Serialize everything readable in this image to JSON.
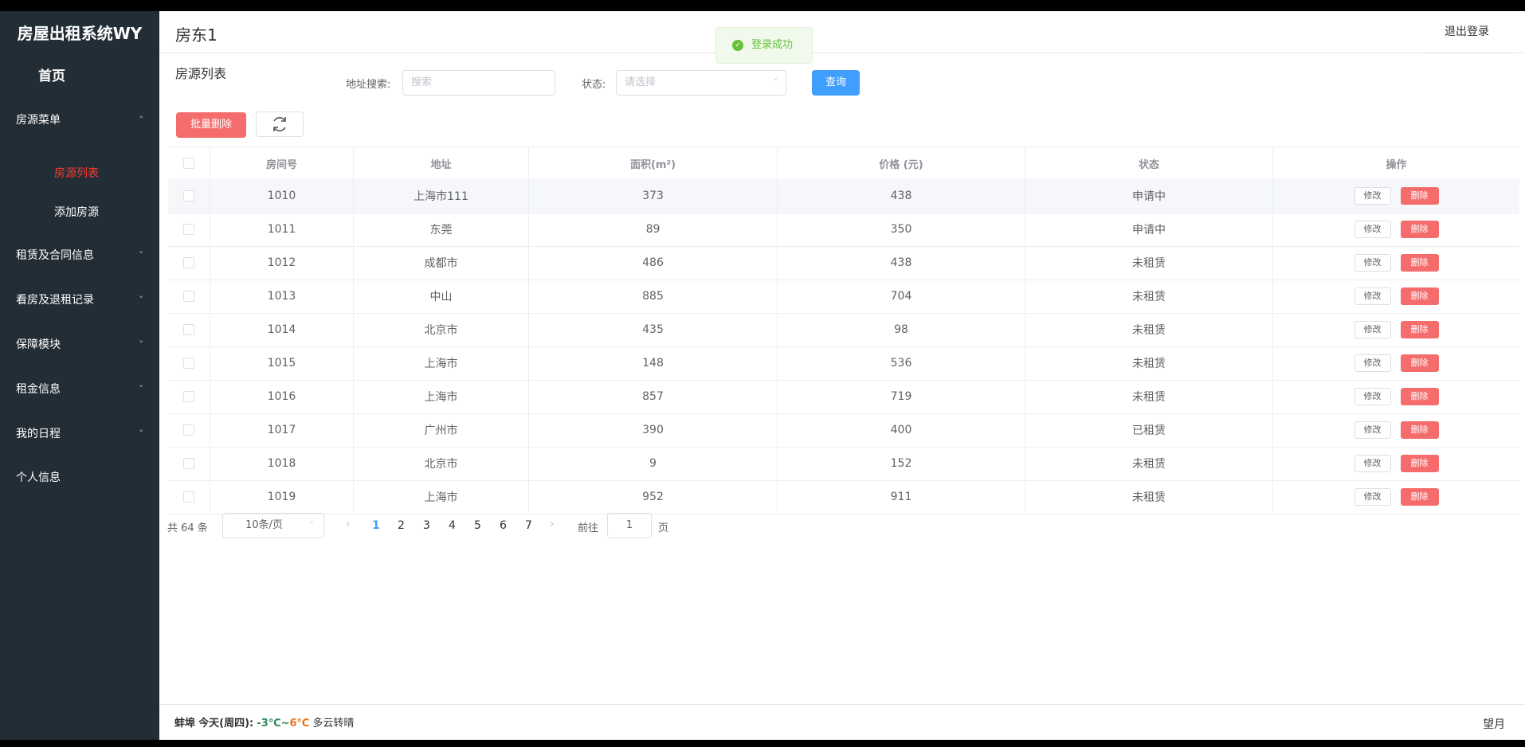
{
  "app": {
    "title": "房屋出租系统WY"
  },
  "sidebar": {
    "home": "首页",
    "groups": [
      {
        "label": "房源菜单",
        "chevron": "chevron-up-icon"
      },
      {
        "label": "租赁及合同信息",
        "chevron": "chevron-down-icon"
      },
      {
        "label": "看房及退租记录",
        "chevron": "chevron-down-icon"
      },
      {
        "label": "保障模块",
        "chevron": "chevron-down-icon"
      },
      {
        "label": "租金信息",
        "chevron": "chevron-down-icon"
      },
      {
        "label": "我的日程",
        "chevron": "chevron-down-icon"
      }
    ],
    "sub_items": [
      "房源列表",
      "添加房源"
    ],
    "personal": "个人信息",
    "active_color": "#ff3b30"
  },
  "header": {
    "title": "房东1",
    "logout": "退出登录"
  },
  "toast": {
    "message": "登录成功"
  },
  "toolbar": {
    "panel_title": "房源列表",
    "address_label": "地址搜索:",
    "address_placeholder": "搜索",
    "status_label": "状态:",
    "status_placeholder": "请选择",
    "query_button": "查询",
    "batch_delete_button": "批量删除",
    "refresh_icon": "refresh-icon"
  },
  "table": {
    "headers": [
      "房间号",
      "地址",
      "面积(m²)",
      "价格 (元)",
      "状态",
      "操作"
    ],
    "edit_label": "修改",
    "delete_label": "删除",
    "rows": [
      {
        "room": "1010",
        "address": "上海市111",
        "area": "373",
        "price": "438",
        "status": "申请中"
      },
      {
        "room": "1011",
        "address": "东莞",
        "area": "89",
        "price": "350",
        "status": "申请中"
      },
      {
        "room": "1012",
        "address": "成都市",
        "area": "486",
        "price": "438",
        "status": "未租赁"
      },
      {
        "room": "1013",
        "address": "中山",
        "area": "885",
        "price": "704",
        "status": "未租赁"
      },
      {
        "room": "1014",
        "address": "北京市",
        "area": "435",
        "price": "98",
        "status": "未租赁"
      },
      {
        "room": "1015",
        "address": "上海市",
        "area": "148",
        "price": "536",
        "status": "未租赁"
      },
      {
        "room": "1016",
        "address": "上海市",
        "area": "857",
        "price": "719",
        "status": "未租赁"
      },
      {
        "room": "1017",
        "address": "广州市",
        "area": "390",
        "price": "400",
        "status": "已租赁"
      },
      {
        "room": "1018",
        "address": "北京市",
        "area": "9",
        "price": "152",
        "status": "未租赁"
      },
      {
        "room": "1019",
        "address": "上海市",
        "area": "952",
        "price": "911",
        "status": "未租赁"
      }
    ]
  },
  "pagination": {
    "total": "共 64 条",
    "page_size": "10条/页",
    "pages": [
      "1",
      "2",
      "3",
      "4",
      "5",
      "6",
      "7"
    ],
    "current": "1",
    "goto_label": "前往",
    "goto_value": "1",
    "page_suffix": "页"
  },
  "footer": {
    "city": "蚌埠",
    "day": "今天(周四):",
    "low": "-3℃",
    "sep": "~",
    "high": "6℃",
    "desc": "多云转晴",
    "user": "望月"
  },
  "colors": {
    "primary": "#409eff",
    "danger": "#f56c6c",
    "success": "#67c23a",
    "sidebar": "#222d36"
  }
}
